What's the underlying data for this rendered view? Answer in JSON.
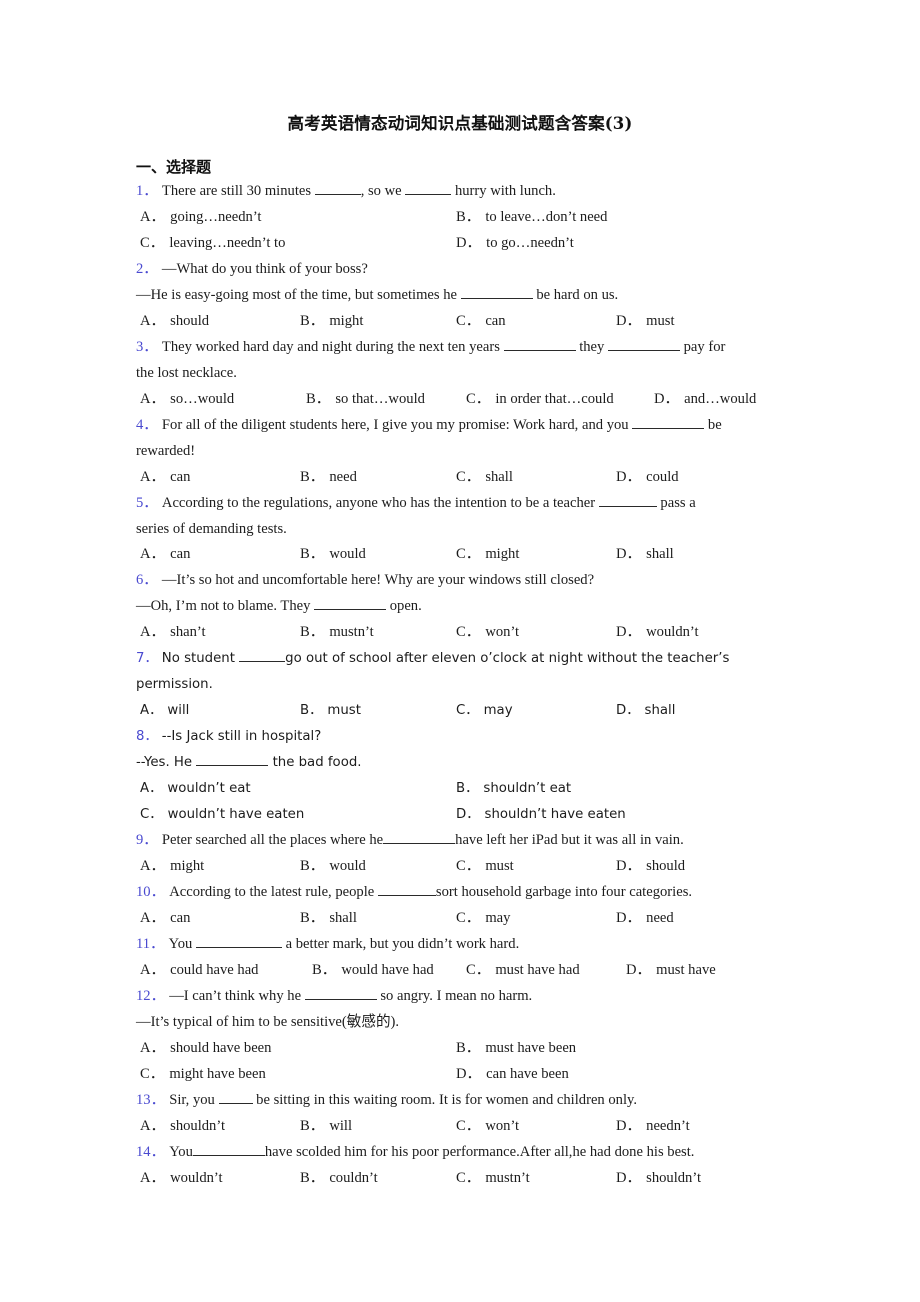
{
  "document": {
    "title": "高考英语情态动词知识点基础测试题含答案(3)",
    "section_heading": "一、选择题",
    "accent_color": "#4a4ad0",
    "text_color": "#1c1c1c"
  },
  "questions": [
    {
      "num": "1．",
      "stem_a": "There are still 30 minutes ",
      "stem_b": ", so we ",
      "stem_c": " hurry with lunch.",
      "layout": "two-col",
      "options": [
        {
          "label": "A．",
          "text": "going…needn’t"
        },
        {
          "label": "B．",
          "text": "to leave…don’t need"
        },
        {
          "label": "C．",
          "text": "leaving…needn’t to"
        },
        {
          "label": "D．",
          "text": "to go…needn’t"
        }
      ]
    },
    {
      "num": "2．",
      "stem_a": "—What do you think of your boss?",
      "cont_a": "—He is easy-going most of the time, but sometimes he ",
      "cont_b": " be hard on us.",
      "layout": "four-col",
      "options": [
        {
          "label": "A．",
          "text": "should"
        },
        {
          "label": "B．",
          "text": "might"
        },
        {
          "label": "C．",
          "text": "can"
        },
        {
          "label": "D．",
          "text": "must"
        }
      ]
    },
    {
      "num": "3．",
      "stem_a": "They worked hard day and night during the next ten years ",
      "stem_b": " they ",
      "stem_c": " pay for",
      "cont_a": "the lost necklace.",
      "layout": "flow",
      "options": [
        {
          "label": "A．",
          "text": "so…would"
        },
        {
          "label": "B．",
          "text": "so that…would"
        },
        {
          "label": "C．",
          "text": "in order that…could"
        },
        {
          "label": "D．",
          "text": "and…would"
        }
      ]
    },
    {
      "num": "4．",
      "stem_a": "For all of the diligent students here, I give you my promise: Work hard, and you ",
      "stem_b": " be",
      "cont_a": "rewarded!",
      "layout": "four-col",
      "options": [
        {
          "label": "A．",
          "text": "can"
        },
        {
          "label": "B．",
          "text": "need"
        },
        {
          "label": "C．",
          "text": "shall"
        },
        {
          "label": "D．",
          "text": "could"
        }
      ]
    },
    {
      "num": "5．",
      "stem_a": "According to the regulations, anyone who has the intention to be a teacher ",
      "stem_b": " pass a",
      "cont_a": "series of demanding tests.",
      "layout": "four-col",
      "options": [
        {
          "label": "A．",
          "text": "can"
        },
        {
          "label": "B．",
          "text": "would"
        },
        {
          "label": "C．",
          "text": "might"
        },
        {
          "label": "D．",
          "text": "shall"
        }
      ]
    },
    {
      "num": "6．",
      "stem_a": "—It’s so hot and uncomfortable here! Why are your windows still closed?",
      "cont_a": " —Oh, I’m not to blame. They ",
      "cont_b": " open.",
      "layout": "four-col",
      "options": [
        {
          "label": "A．",
          "text": "shan’t"
        },
        {
          "label": "B．",
          "text": "mustn’t"
        },
        {
          "label": "C．",
          "text": "won’t"
        },
        {
          "label": "D．",
          "text": "wouldn’t"
        }
      ]
    },
    {
      "num": "7．",
      "stem_a": "No student ",
      "stem_b": "go out of school after eleven o’clock at night without the teacher’s",
      "cont_a": "permission.",
      "layout": "four-col",
      "font": "sans",
      "options": [
        {
          "label": "A．",
          "text": "will"
        },
        {
          "label": "B．",
          "text": "must"
        },
        {
          "label": "C．",
          "text": "may"
        },
        {
          "label": "D．",
          "text": "shall"
        }
      ]
    },
    {
      "num": "8．",
      "stem_a": "--Is Jack still in hospital?",
      "cont_a": "--Yes. He ",
      "cont_b": " the bad food.",
      "layout": "two-col",
      "font": "sans",
      "options": [
        {
          "label": "A．",
          "text": "wouldn’t eat"
        },
        {
          "label": "B．",
          "text": "shouldn’t eat"
        },
        {
          "label": "C．",
          "text": "wouldn’t have eaten"
        },
        {
          "label": "D．",
          "text": "shouldn’t have eaten"
        }
      ]
    },
    {
      "num": "9．",
      "stem_a": "Peter searched all the places where he",
      "stem_b": "have left her iPad but it was all in vain.",
      "layout": "four-col",
      "options": [
        {
          "label": "A．",
          "text": "might"
        },
        {
          "label": "B．",
          "text": "would"
        },
        {
          "label": "C．",
          "text": "must"
        },
        {
          "label": "D．",
          "text": "should"
        }
      ]
    },
    {
      "num": "10．",
      "stem_a": "According to the latest rule, people ",
      "stem_b": "sort household garbage into four categories.",
      "layout": "four-col",
      "options": [
        {
          "label": "A．",
          "text": "can"
        },
        {
          "label": "B．",
          "text": "shall"
        },
        {
          "label": "C．",
          "text": "may"
        },
        {
          "label": "D．",
          "text": "need"
        }
      ]
    },
    {
      "num": "11．",
      "stem_a": "You ",
      "stem_b": " a better mark, but you didn’t work hard.",
      "layout": "custom-four",
      "options": [
        {
          "label": "A．",
          "text": "could have had"
        },
        {
          "label": "B．",
          "text": "would have had"
        },
        {
          "label": "C．",
          "text": "must have had"
        },
        {
          "label": "D．",
          "text": "must have"
        }
      ]
    },
    {
      "num": "12．",
      "stem_a": "—I can’t think why he ",
      "stem_b": " so angry. I mean no harm.",
      "cont_a": "—It’s typical of him to be sensitive(敏感的).",
      "layout": "two-col",
      "options": [
        {
          "label": "A．",
          "text": "should have been"
        },
        {
          "label": "B．",
          "text": "must have been"
        },
        {
          "label": "C．",
          "text": "might have been"
        },
        {
          "label": "D．",
          "text": "can have been"
        }
      ]
    },
    {
      "num": "13．",
      "stem_a": "Sir, you ",
      "stem_b": " be sitting in this waiting room. It is for women and children only.",
      "layout": "four-col",
      "options": [
        {
          "label": "A．",
          "text": "shouldn’t"
        },
        {
          "label": "B．",
          "text": "will"
        },
        {
          "label": "C．",
          "text": "won’t"
        },
        {
          "label": "D．",
          "text": "needn’t"
        }
      ]
    },
    {
      "num": "14．",
      "stem_a": "You",
      "stem_b": "have scolded him for his poor performance.After all,he had done his best.",
      "layout": "four-col",
      "options": [
        {
          "label": "A．",
          "text": "wouldn’t"
        },
        {
          "label": "B．",
          "text": "couldn’t"
        },
        {
          "label": "C．",
          "text": "mustn’t"
        },
        {
          "label": "D．",
          "text": "shouldn’t"
        }
      ]
    }
  ]
}
